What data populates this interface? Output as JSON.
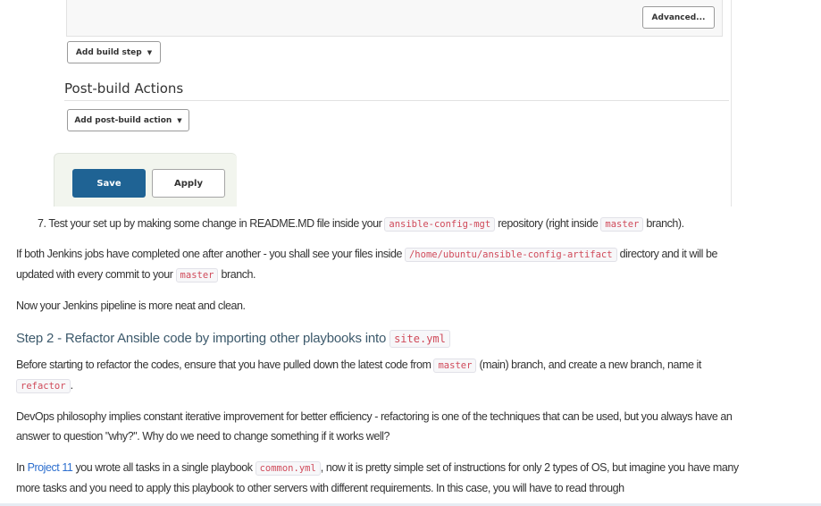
{
  "jenkins_screenshot": {
    "advanced_button": "Advanced...",
    "add_build_step_button": "Add build step",
    "post_build_title": "Post-build Actions",
    "add_post_build_button": "Add post-build action",
    "save_button": "Save",
    "apply_button": "Apply",
    "caret": "▼"
  },
  "steps": {
    "step7": {
      "prefix": "7. Test your set up by making some change in README.MD file inside your ",
      "code1": "ansible-config-mgt",
      "middle": " repository (right inside ",
      "code2": "master",
      "suffix": " branch)."
    }
  },
  "paragraphs": {
    "p1": {
      "prefix": "If both Jenkins jobs have completed one after another - you shall see your files inside ",
      "code1": "/home/ubuntu/ansible-config-artifact",
      "middle": " directory and it will be updated with every commit to your ",
      "code2": "master",
      "suffix": " branch."
    },
    "p2": "Now your Jenkins pipeline is more neat and clean.",
    "step2_heading": {
      "text": "Step 2 - Refactor Ansible code by importing other playbooks into ",
      "code": "site.yml"
    },
    "p3": {
      "prefix": "Before starting to refactor the codes, ensure that you have pulled down the latest code from ",
      "code1": "master",
      "middle": " (main) branch, and create a new branch, name it ",
      "code2": "refactor",
      "suffix": "."
    },
    "p4": "DevOps philosophy implies constant iterative improvement for better efficiency - refactoring is one of the techniques that can be used, but you always have an answer to question \"why?\". Why do we need to change something if it works well?",
    "p5": {
      "prefix": "In ",
      "link": "Project 11",
      "middle": " you wrote all tasks in a single playbook ",
      "code": "common.yml",
      "suffix": ", now it is pretty simple set of instructions for only 2 types of OS, but imagine you have many more tasks and you need to apply this playbook to other servers with different requirements. In this case, you will have to read through"
    }
  }
}
